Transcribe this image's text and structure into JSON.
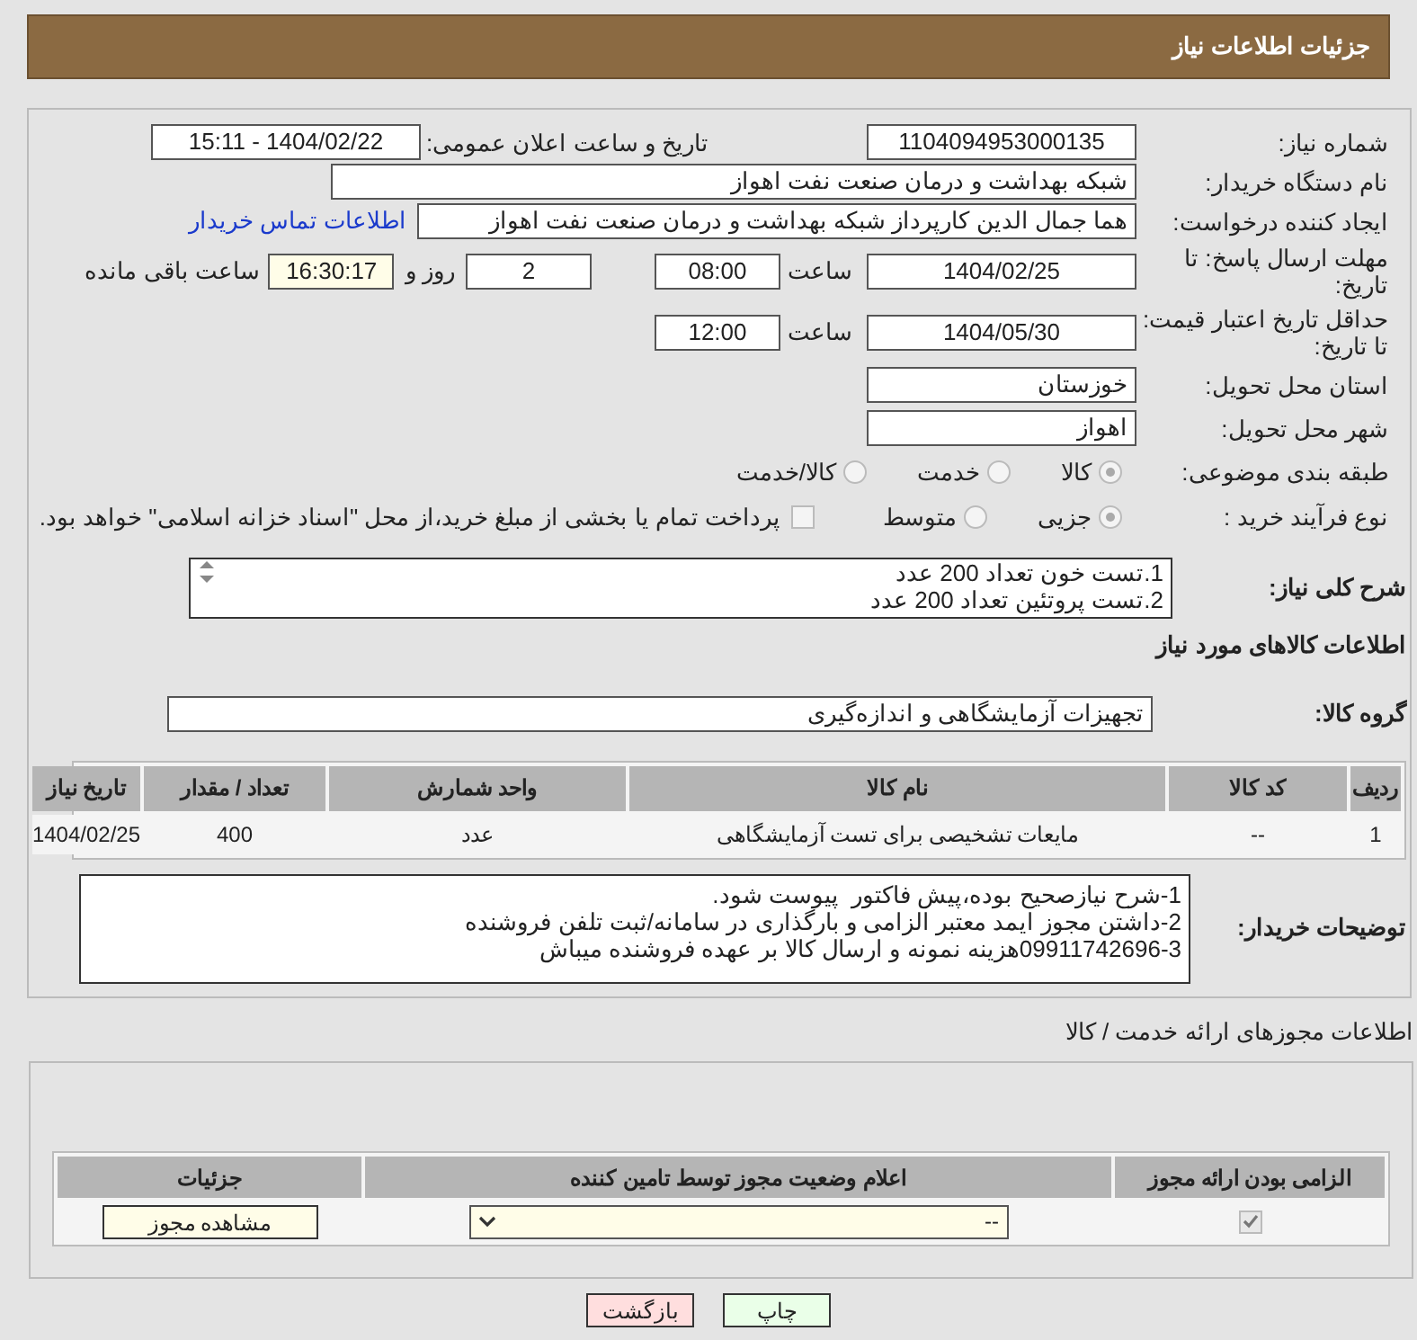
{
  "header": {
    "title": "جزئیات اطلاعات نیاز"
  },
  "need_number": {
    "label": "شماره نیاز:",
    "value": "1104094953000135"
  },
  "announce": {
    "label": "تاریخ و ساعت اعلان عمومی:",
    "value": "1404/02/22 - 15:11"
  },
  "buyer": {
    "label": "نام دستگاه خریدار:",
    "value": "شبکه بهداشت و درمان صنعت نفت اهواز"
  },
  "requester": {
    "label": "ایجاد کننده درخواست:",
    "value": "هما جمال الدین کارپرداز شبکه بهداشت و درمان صنعت نفت اهواز",
    "link": "اطلاعات تماس خریدار"
  },
  "deadline": {
    "label": "مهلت ارسال پاسخ: تا تاریخ:",
    "date": "1404/02/25",
    "time_label": "ساعت",
    "time": "08:00",
    "days": "2",
    "days_label": "روز و",
    "remaining": "16:30:17",
    "remaining_label": "ساعت باقی مانده"
  },
  "validity": {
    "label": "حداقل تاریخ اعتبار قیمت: تا تاریخ:",
    "date": "1404/05/30",
    "time_label": "ساعت",
    "time": "12:00"
  },
  "province": {
    "label": "استان محل تحویل:",
    "value": "خوزستان"
  },
  "city": {
    "label": "شهر محل تحویل:",
    "value": "اهواز"
  },
  "category": {
    "label": "طبقه بندی موضوعی:",
    "options": [
      {
        "label": "کالا",
        "selected": true
      },
      {
        "label": "خدمت",
        "selected": false
      },
      {
        "label": "کالا/خدمت",
        "selected": false
      }
    ]
  },
  "process": {
    "label": "نوع فرآیند خرید :",
    "options": [
      {
        "label": "جزیی",
        "selected": true
      },
      {
        "label": "متوسط",
        "selected": false
      }
    ],
    "treasury": {
      "checked": false,
      "label": "پرداخت تمام یا بخشی از مبلغ خرید،از محل \"اسناد خزانه اسلامی\" خواهد بود."
    }
  },
  "description": {
    "label": "شرح کلی نیاز:",
    "lines": [
      "1.تست خون تعداد 200 عدد",
      "2.تست پروتئین تعداد 200 عدد"
    ]
  },
  "goods": {
    "title": "اطلاعات کالاهای مورد نیاز",
    "group_label": "گروه کالا:",
    "group": "تجهیزات آزمایشگاهی و اندازه‌گیری",
    "columns": [
      "ردیف",
      "کد کالا",
      "نام کالا",
      "واحد شمارش",
      "تعداد / مقدار",
      "تاریخ نیاز"
    ],
    "rows": [
      [
        "1",
        "--",
        "مایعات تشخیصی برای تست آزمایشگاهی",
        "عدد",
        "400",
        "1404/02/25"
      ]
    ]
  },
  "notes": {
    "label": "توضیحات خریدار:",
    "lines": [
      "1-شرح نیازصحیح بوده،پیش فاکتور  پیوست شود.",
      "2-داشتن مجوز ایمد معتبر الزامی و بارگذاری در سامانه/ثبت تلفن فروشنده",
      "09911742696-3هزینه نمونه و ارسال کالا بر عهده فروشنده میباش"
    ]
  },
  "licenses": {
    "title": "اطلاعات مجوزهای ارائه خدمت / کالا",
    "columns": [
      "الزامی بودن ارائه مجوز",
      "اعلام وضعیت مجوز توسط تامین کننده",
      "جزئیات"
    ],
    "rows": [
      {
        "required": true,
        "status": "--",
        "button": "مشاهده مجوز"
      }
    ]
  },
  "buttons": [
    {
      "label": "چاپ",
      "kind": "print"
    },
    {
      "label": "بازگشت",
      "kind": "back"
    }
  ]
}
